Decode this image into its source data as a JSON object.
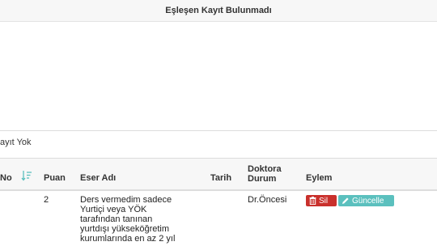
{
  "banner": {
    "text": "Eşleşen Kayıt Bulunmadı"
  },
  "status": {
    "text": "ayıt Yok"
  },
  "table": {
    "headers": {
      "no": "No",
      "puan": "Puan",
      "eser_adi": "Eser Adı",
      "tarih": "Tarih",
      "doktora_line1": "Doktora",
      "doktora_line2": "Durum",
      "eylem": "Eylem"
    },
    "rows": [
      {
        "puan": "2",
        "eser_lines": [
          "Ders vermedim sadece",
          "Yurtiçi veya YÖK",
          "tarafından tanınan",
          "yurtdışı yükseköğretim",
          "kurumlarında en az 2 yıl"
        ],
        "durum": "Dr.Öncesi",
        "actions": {
          "sil": "Sil",
          "guncelle": "Güncelle"
        }
      }
    ]
  },
  "icons": {
    "sort": "sort-descending-icon",
    "trash": "trash-icon",
    "pencil": "pencil-icon"
  },
  "colors": {
    "sort_icon": "#5bc0be",
    "delete_button": "#c9302c",
    "update_button": "#5bc0be"
  }
}
